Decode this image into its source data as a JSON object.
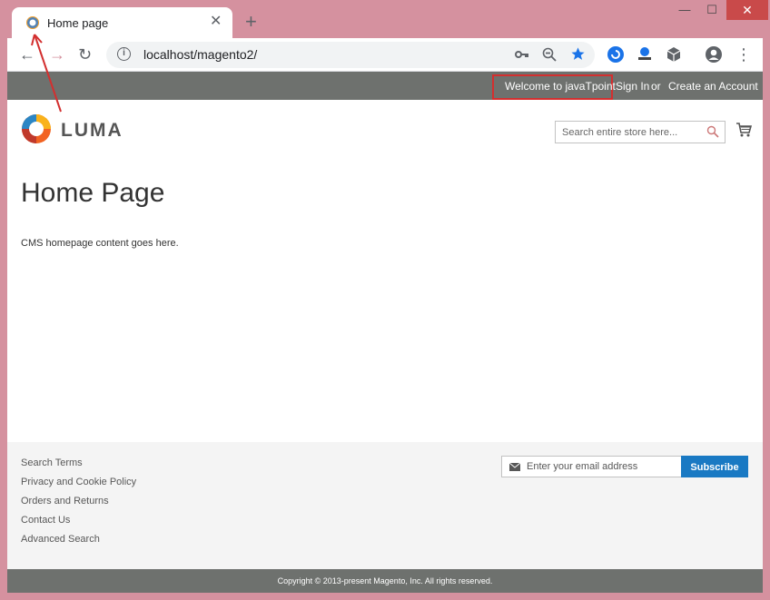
{
  "browser": {
    "tab_title": "Home page",
    "tab_close": "✕",
    "new_tab": "+",
    "url": "localhost/magento2/",
    "window_minimize": "—",
    "window_maximize": "☐",
    "window_close": "✕",
    "back": "←",
    "forward": "→",
    "reload": "↻",
    "menu": "⋮"
  },
  "header": {
    "welcome": "Welcome to javaTpoint",
    "sign_in": "Sign In",
    "or": "or",
    "create_account": "Create an Account"
  },
  "logo": {
    "text": "LUMA"
  },
  "search": {
    "placeholder": "Search entire store here..."
  },
  "main": {
    "title": "Home Page",
    "content": "CMS homepage content goes here."
  },
  "footer": {
    "links": [
      "Search Terms",
      "Privacy and Cookie Policy",
      "Orders and Returns",
      "Contact Us",
      "Advanced Search"
    ],
    "newsletter_placeholder": "Enter your email address",
    "subscribe": "Subscribe",
    "copyright": "Copyright © 2013-present Magento, Inc. All rights reserved."
  },
  "colors": {
    "frame": "#d5919f",
    "panel": "#6e716e",
    "accent": "#1979c3",
    "highlight": "#d32f2f"
  }
}
